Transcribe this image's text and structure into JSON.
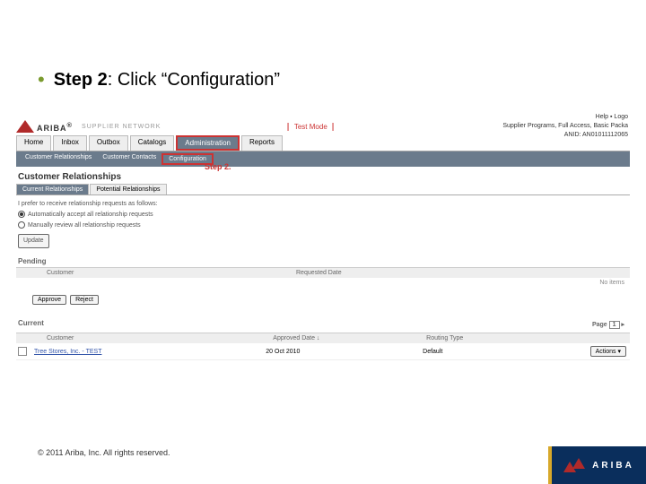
{
  "heading": {
    "bullet": "•",
    "step_label": "Step 2",
    "separator": ":  ",
    "action": "Click “Configuration”"
  },
  "brand": {
    "name": "ARIBA",
    "reg": "®",
    "network": "SUPPLIER NETWORK",
    "testmode": "Test Mode"
  },
  "topright": {
    "help": "Help",
    "logout": "Logo",
    "line1": "Supplier Programs, Full Access, Basic Packa",
    "line2": "ANID: AN01011112065"
  },
  "tabs": [
    "Home",
    "Inbox",
    "Outbox",
    "Catalogs",
    "Administration",
    "Reports"
  ],
  "subtabs": [
    "Customer Relationships",
    "Customer Contacts",
    "Configuration"
  ],
  "step2_label": "Step 2.",
  "section_title": "Customer Relationships",
  "minitabs": [
    "Current Relationships",
    "Potential Relationships"
  ],
  "prefs": {
    "intro": "I prefer to receive relationship requests as follows:",
    "opt1": "Automatically accept all relationship requests",
    "opt2": "Manually review all relationship requests",
    "update": "Update"
  },
  "pending": {
    "title": "Pending",
    "col_customer": "Customer",
    "col_date": "Requested Date",
    "no_items": "No items",
    "approve": "Approve",
    "reject": "Reject"
  },
  "current": {
    "title": "Current",
    "pager_label": "Page",
    "pager_value": "1",
    "pager_arrow": "▸",
    "col_customer": "Customer",
    "col_date": "Approved Date ↓",
    "col_route": "Routing Type",
    "row_customer": "Tree Stores, Inc. - TEST",
    "row_date": "20 Oct 2010",
    "row_route": "Default",
    "row_action": "Actions ▾"
  },
  "footer": "© 2011 Ariba, Inc. All rights reserved.",
  "footer_brand": "ARIBA"
}
